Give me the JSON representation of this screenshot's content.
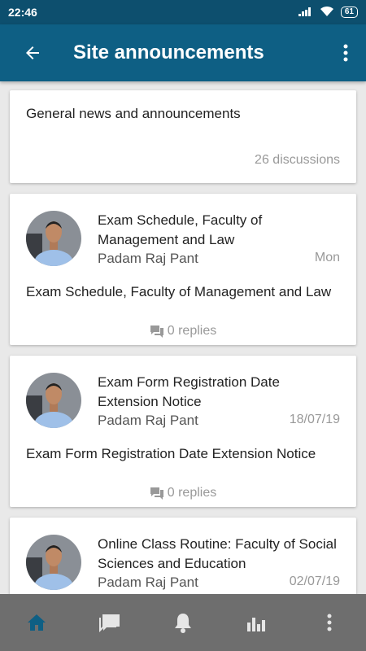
{
  "status_bar": {
    "time": "22:46",
    "battery": "61"
  },
  "app_bar": {
    "title": "Site announcements"
  },
  "forum": {
    "name": "General news and announcements",
    "discussion_count": "26 discussions"
  },
  "discussions": [
    {
      "subject": "Exam Schedule, Faculty of Management and Law",
      "author": "Padam Raj Pant",
      "date": "Mon",
      "message": "Exam Schedule, Faculty of Management and Law",
      "replies": "0 replies"
    },
    {
      "subject": "Exam Form Registration Date Extension Notice",
      "author": "Padam Raj Pant",
      "date": "18/07/19",
      "message": "Exam Form Registration Date Extension Notice",
      "replies": "0 replies"
    },
    {
      "subject": "Online Class Routine: Faculty of Social Sciences and Education",
      "author": "Padam Raj Pant",
      "date": "02/07/19",
      "message": "",
      "replies": ""
    }
  ],
  "bottom_nav": {
    "items": [
      "home-icon",
      "messages-icon",
      "notifications-icon",
      "grades-icon",
      "more-vertical-icon"
    ],
    "active_color": "#0e5f84",
    "inactive_color": "#e6e6e6"
  },
  "colors": {
    "app_bar": "#0e5f84",
    "status_bar": "#0d4f6e"
  }
}
